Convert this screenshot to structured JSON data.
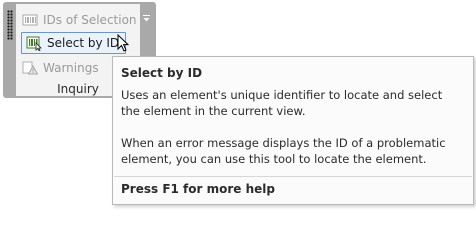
{
  "panel": {
    "title": "Inquiry",
    "tools": [
      {
        "label": "IDs of  Selection",
        "icon": "ids-of-selection-icon",
        "enabled": false
      },
      {
        "label": "Select  by ID",
        "icon": "select-by-id-icon",
        "enabled": true,
        "hovered": true
      },
      {
        "label": "Warnings",
        "icon": "warnings-icon",
        "enabled": false
      }
    ]
  },
  "tooltip": {
    "title": "Select by ID",
    "paragraph1": "Uses an element's unique identifier to locate and select the element in the current view.",
    "paragraph2": "When an error message displays the ID of a problematic element, you can use this tool to locate the element.",
    "help": "Press F1 for more help"
  },
  "colors": {
    "panel_frame": "#a9a9a9",
    "panel_body": "#f3f3f3",
    "hover_border": "#6f93c7",
    "hover_fill": "#eaf3fb",
    "disabled_text": "#9a9a9a"
  }
}
